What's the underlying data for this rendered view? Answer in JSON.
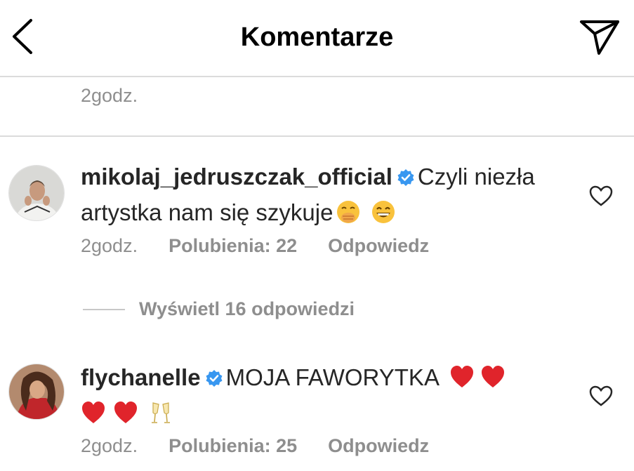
{
  "header": {
    "title": "Komentarze",
    "back_icon": "chevron-left-icon",
    "send_icon": "paper-plane-icon"
  },
  "top_comment_meta": {
    "time": "2godz."
  },
  "comments": [
    {
      "username": "mikolaj_jedruszczak_official",
      "verified": true,
      "text": "Czyli niezła artystka nam się szykuje",
      "emojis": [
        "face-with-hand-over-mouth",
        "grinning-face-with-smiling-eyes"
      ],
      "time": "2godz.",
      "likes": "Polubienia: 22",
      "reply": "Odpowiedz",
      "view_replies": "Wyświetl 16 odpowiedzi"
    },
    {
      "username": "flychanelle",
      "verified": true,
      "text": "MOJA FAWORYTKA",
      "emojis": [
        "red-heart",
        "red-heart",
        "red-heart",
        "red-heart",
        "clinking-glasses"
      ],
      "time": "2godz.",
      "likes": "Polubienia: 25",
      "reply": "Odpowiedz"
    }
  ],
  "colors": {
    "verified_blue": "#3897f0",
    "secondary_text": "#8e8e8e",
    "divider": "#dbdbdb",
    "heart_red": "#e0242b"
  }
}
